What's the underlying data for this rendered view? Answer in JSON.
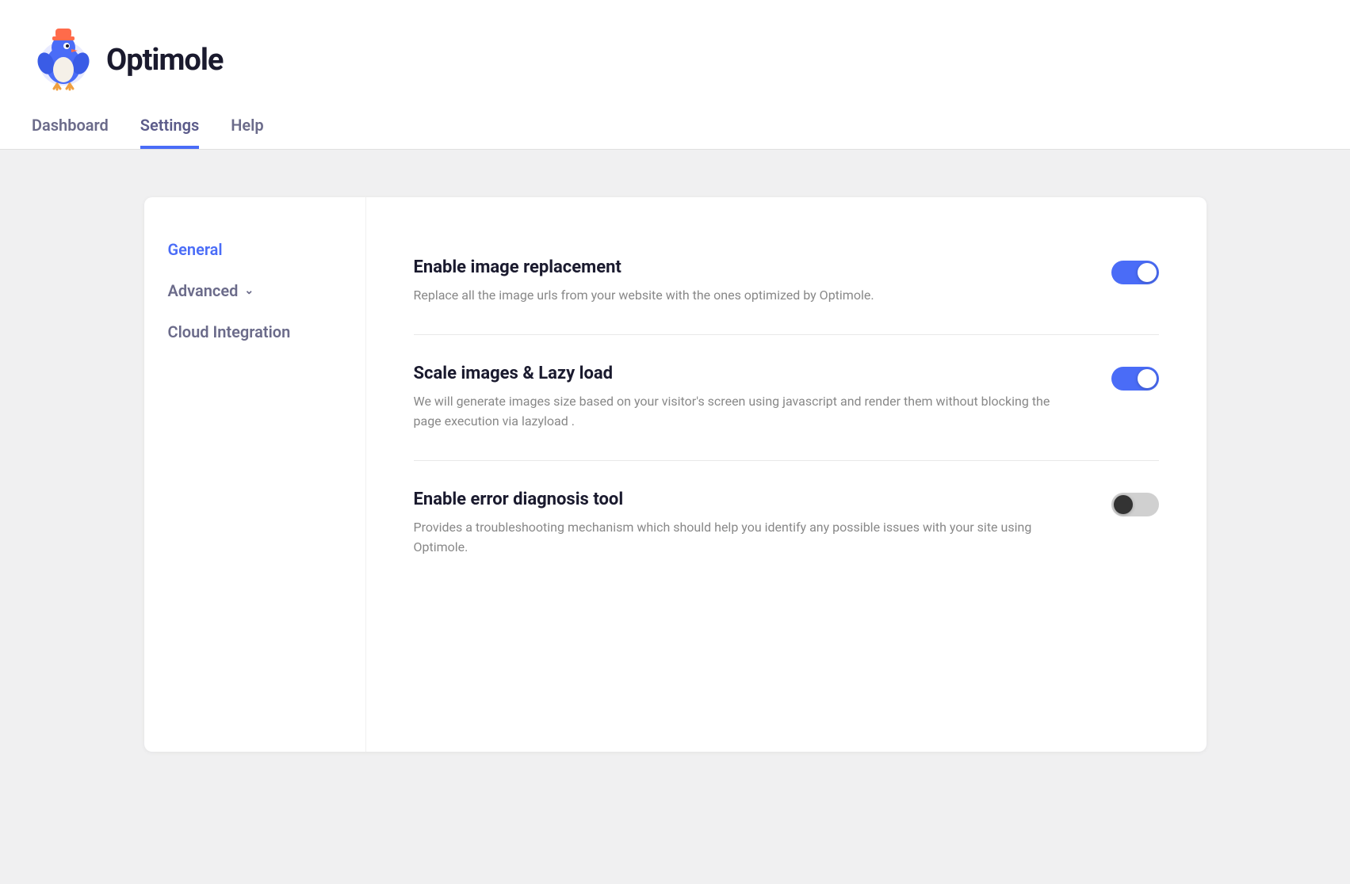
{
  "app": {
    "name": "Optimole"
  },
  "nav": {
    "tabs": [
      {
        "id": "dashboard",
        "label": "Dashboard",
        "active": false
      },
      {
        "id": "settings",
        "label": "Settings",
        "active": true
      },
      {
        "id": "help",
        "label": "Help",
        "active": false
      }
    ]
  },
  "sidebar": {
    "items": [
      {
        "id": "general",
        "label": "General",
        "active": true,
        "hasChevron": false
      },
      {
        "id": "advanced",
        "label": "Advanced",
        "active": false,
        "hasChevron": true
      },
      {
        "id": "cloud-integration",
        "label": "Cloud Integration",
        "active": false,
        "hasChevron": false
      }
    ]
  },
  "settings": {
    "rows": [
      {
        "id": "enable-image-replacement",
        "title": "Enable image replacement",
        "description": "Replace all the image urls from your website with the ones optimized by Optimole.",
        "enabled": true
      },
      {
        "id": "scale-images-lazy-load",
        "title": "Scale images & Lazy load",
        "description": "We will generate images size based on your visitor's screen using javascript and render them without blocking the page execution via lazyload .",
        "enabled": true
      },
      {
        "id": "enable-error-diagnosis",
        "title": "Enable error diagnosis tool",
        "description": "Provides a troubleshooting mechanism which should help you identify any possible issues with your site using Optimole.",
        "enabled": false
      }
    ]
  }
}
